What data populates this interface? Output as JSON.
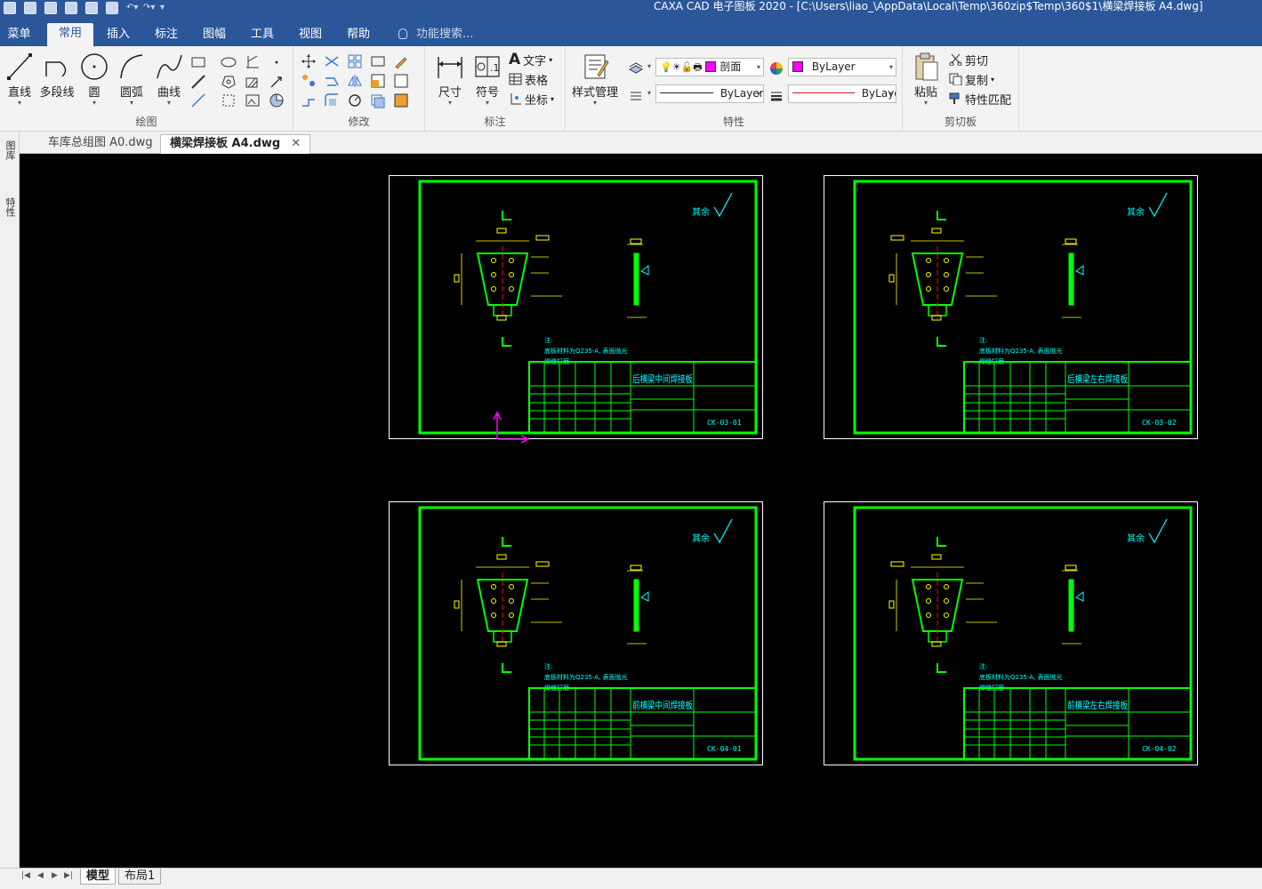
{
  "window": {
    "title": "CAXA CAD 电子图板 2020 - [C:\\Users\\liao_\\AppData\\Local\\Temp\\360zip$Temp\\360$1\\横梁焊接板 A4.dwg]"
  },
  "menu": {
    "items": [
      "菜单",
      "常用",
      "插入",
      "标注",
      "图幅",
      "工具",
      "视图",
      "帮助"
    ],
    "active": "常用",
    "search_placeholder": "功能搜索..."
  },
  "ribbon": {
    "draw": {
      "label": "绘图",
      "buttons": [
        "直线",
        "多段线",
        "圆",
        "圆弧",
        "曲线"
      ]
    },
    "modify": {
      "label": "修改"
    },
    "annotate": {
      "label": "标注",
      "buttons": [
        "尺寸",
        "符号"
      ],
      "small": [
        "文字",
        "表格",
        "坐标"
      ]
    },
    "properties": {
      "label": "特性",
      "style_button": "样式管理",
      "layer_value": "剖面",
      "color_value": "ByLayer",
      "linetype_value": "ByLayer",
      "lineweight_value": "ByLaye"
    },
    "clipboard": {
      "label": "剪切板",
      "paste": "粘贴",
      "small": [
        "剪切",
        "复制",
        "特性匹配"
      ]
    }
  },
  "doc_tabs": [
    {
      "label": "车库总组图 A0.dwg",
      "active": false
    },
    {
      "label": "横梁焊接板 A4.dwg",
      "active": true
    }
  ],
  "side_panel": {
    "tabs": [
      "图库",
      "特性"
    ]
  },
  "drawing": {
    "colors": {
      "frame": "#00ff00",
      "text": "#00ffff",
      "dims": "#ffff00",
      "center": "#ff0000",
      "ucs": "#ff00ff",
      "border": "#ffffff"
    },
    "sheets": [
      {
        "title": "后横梁中间焊接板",
        "code": "CK-03-01"
      },
      {
        "title": "后横梁左右焊接板",
        "code": "CK-03-02"
      },
      {
        "title": "前横梁中间焊接板",
        "code": "CK-04-01"
      },
      {
        "title": "前横梁左右焊接板",
        "code": "CK-04-02"
      }
    ],
    "roughness_note": "其余",
    "notes": [
      "注:",
      "底板材料为Q235-A, 表面抛光",
      "焊缝打磨"
    ]
  },
  "status": {
    "layout_tabs": [
      "模型",
      "布局1"
    ],
    "active_layout": "模型"
  }
}
